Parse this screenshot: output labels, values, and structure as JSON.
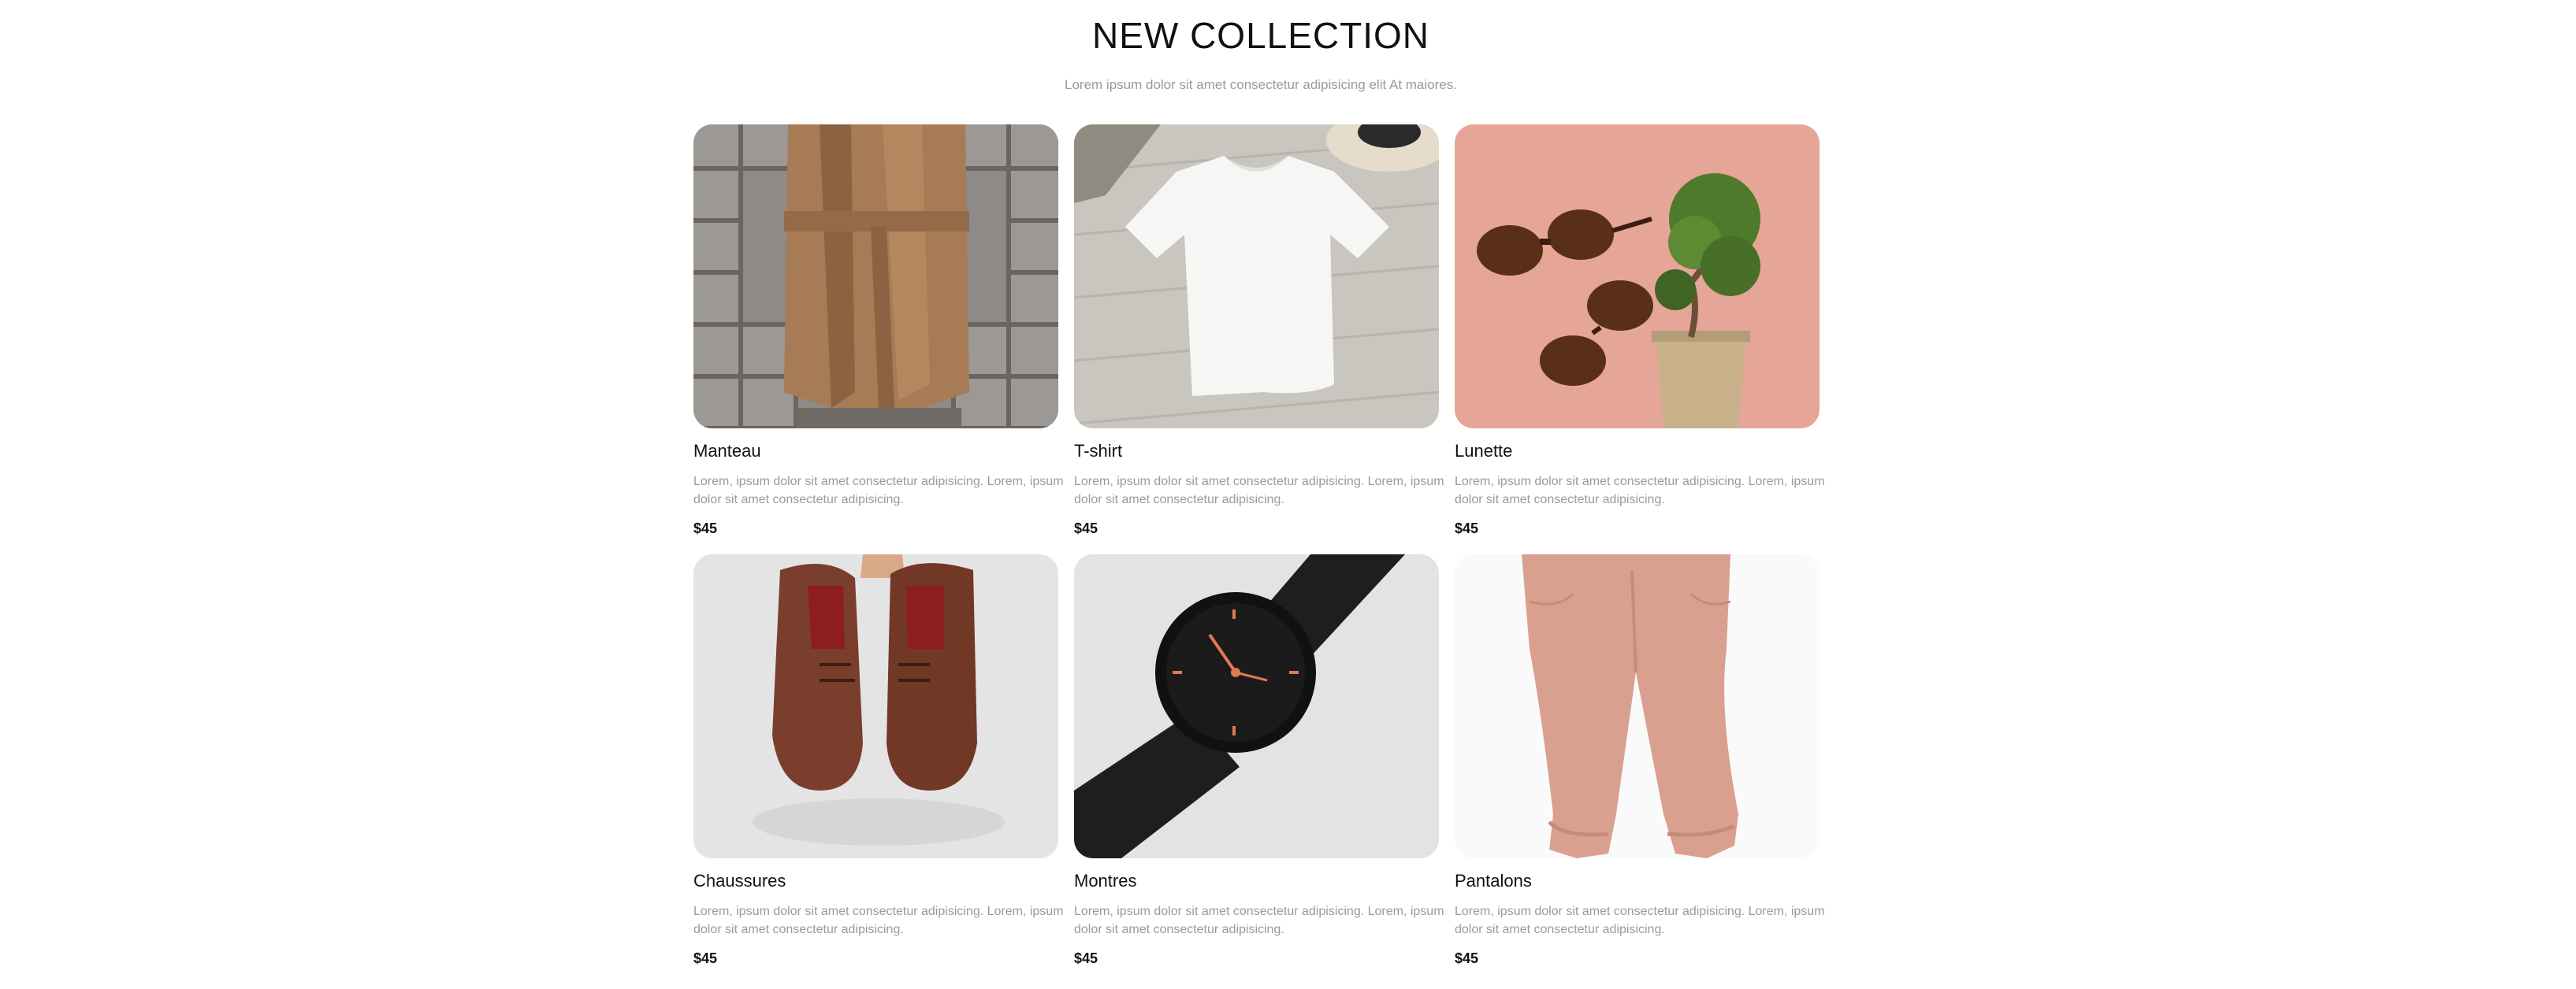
{
  "section": {
    "title": "NEW COLLECTION",
    "subtitle": "Lorem ipsum dolor sit amet consectetur adipisicing elit At maiores."
  },
  "products": [
    {
      "name": "Manteau",
      "description": "Lorem, ipsum dolor sit amet consectetur adipisicing. Lorem, ipsum dolor sit amet consectetur adipisicing.",
      "price": "$45",
      "image_icon": "coat-image"
    },
    {
      "name": "T-shirt",
      "description": "Lorem, ipsum dolor sit amet consectetur adipisicing. Lorem, ipsum dolor sit amet consectetur adipisicing.",
      "price": "$45",
      "image_icon": "tshirt-image"
    },
    {
      "name": "Lunette",
      "description": "Lorem, ipsum dolor sit amet consectetur adipisicing. Lorem, ipsum dolor sit amet consectetur adipisicing.",
      "price": "$45",
      "image_icon": "sunglasses-image"
    },
    {
      "name": "Chaussures",
      "description": "Lorem, ipsum dolor sit amet consectetur adipisicing. Lorem, ipsum dolor sit amet consectetur adipisicing.",
      "price": "$45",
      "image_icon": "shoes-image"
    },
    {
      "name": "Montres",
      "description": "Lorem, ipsum dolor sit amet consectetur adipisicing. Lorem, ipsum dolor sit amet consectetur adipisicing.",
      "price": "$45",
      "image_icon": "watch-image"
    },
    {
      "name": "Pantalons",
      "description": "Lorem, ipsum dolor sit amet consectetur adipisicing. Lorem, ipsum dolor sit amet consectetur adipisicing.",
      "price": "$45",
      "image_icon": "pants-image"
    }
  ],
  "colors": {
    "title": "#111111",
    "muted_text": "#9a9a9a",
    "background": "#ffffff"
  }
}
